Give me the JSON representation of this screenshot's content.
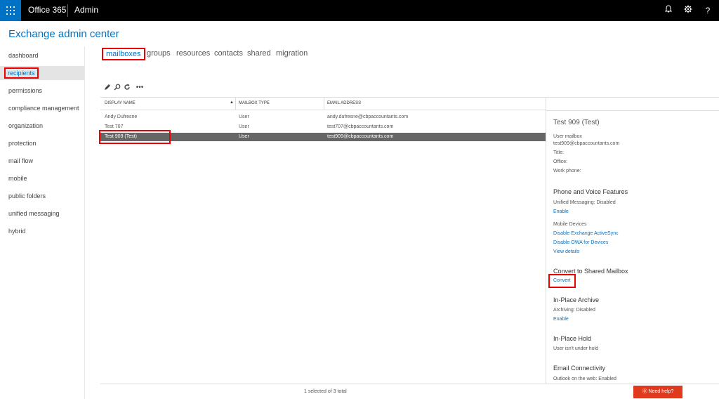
{
  "topbar": {
    "brand": "Office 365",
    "section": "Admin",
    "icons": [
      "bell-icon",
      "gear-icon",
      "help-icon"
    ],
    "help_glyph": "?"
  },
  "page": {
    "title": "Exchange admin center"
  },
  "leftnav": {
    "items": [
      {
        "label": "dashboard"
      },
      {
        "label": "recipients",
        "selected": true
      },
      {
        "label": "permissions"
      },
      {
        "label": "compliance management"
      },
      {
        "label": "organization"
      },
      {
        "label": "protection"
      },
      {
        "label": "mail flow"
      },
      {
        "label": "mobile"
      },
      {
        "label": "public folders"
      },
      {
        "label": "unified messaging"
      },
      {
        "label": "hybrid"
      }
    ]
  },
  "tabs": [
    {
      "label": "mailboxes",
      "active": true
    },
    {
      "label": "groups"
    },
    {
      "label": "resources"
    },
    {
      "label": "contacts"
    },
    {
      "label": "shared"
    },
    {
      "label": "migration"
    }
  ],
  "toolbar": {
    "more_label": "•••"
  },
  "table": {
    "columns": [
      "DISPLAY NAME",
      "MAILBOX TYPE",
      "EMAIL ADDRESS"
    ],
    "sort_indicator": "▲",
    "rows": [
      {
        "name": "Andy Dufresne",
        "type": "User",
        "email": "andy.dufresne@cbpaccountants.com"
      },
      {
        "name": "Test 707",
        "type": "User",
        "email": "test707@cbpaccountants.com"
      },
      {
        "name": "Test 909 (Test)",
        "type": "User",
        "email": "test909@cbpaccountants.com",
        "selected": true
      }
    ]
  },
  "detail": {
    "title": "Test 909 (Test)",
    "mailbox_kind": "User mailbox",
    "email": "test909@cbpaccountants.com",
    "title_label": "Title:",
    "office_label": "Office:",
    "workphone_label": "Work phone:",
    "phone_section": "Phone and Voice Features",
    "um_label": "Unified Messaging:",
    "um_value": "Disabled",
    "um_enable": "Enable",
    "mobile_devices": "Mobile Devices",
    "disable_eas": "Disable Exchange ActiveSync",
    "disable_owa": "Disable OWA for Devices",
    "view_details": "View details",
    "convert_section": "Convert to Shared Mailbox",
    "convert_link": "Convert",
    "archive_section": "In-Place Archive",
    "archiving_label": "Archiving:",
    "archiving_value": "Disabled",
    "archive_enable": "Enable",
    "hold_section": "In-Place Hold",
    "hold_text": "User isn't under hold",
    "email_conn_section": "Email Connectivity",
    "owa_label": "Outlook on the web:",
    "owa_value": "Enabled"
  },
  "status": {
    "selection": "1 selected of 3 total"
  },
  "help_button": {
    "label": "Need help?"
  },
  "colors": {
    "accent": "#0072c6",
    "highlight": "#e00000",
    "help": "#e03a1e",
    "selected_row": "#666666"
  }
}
